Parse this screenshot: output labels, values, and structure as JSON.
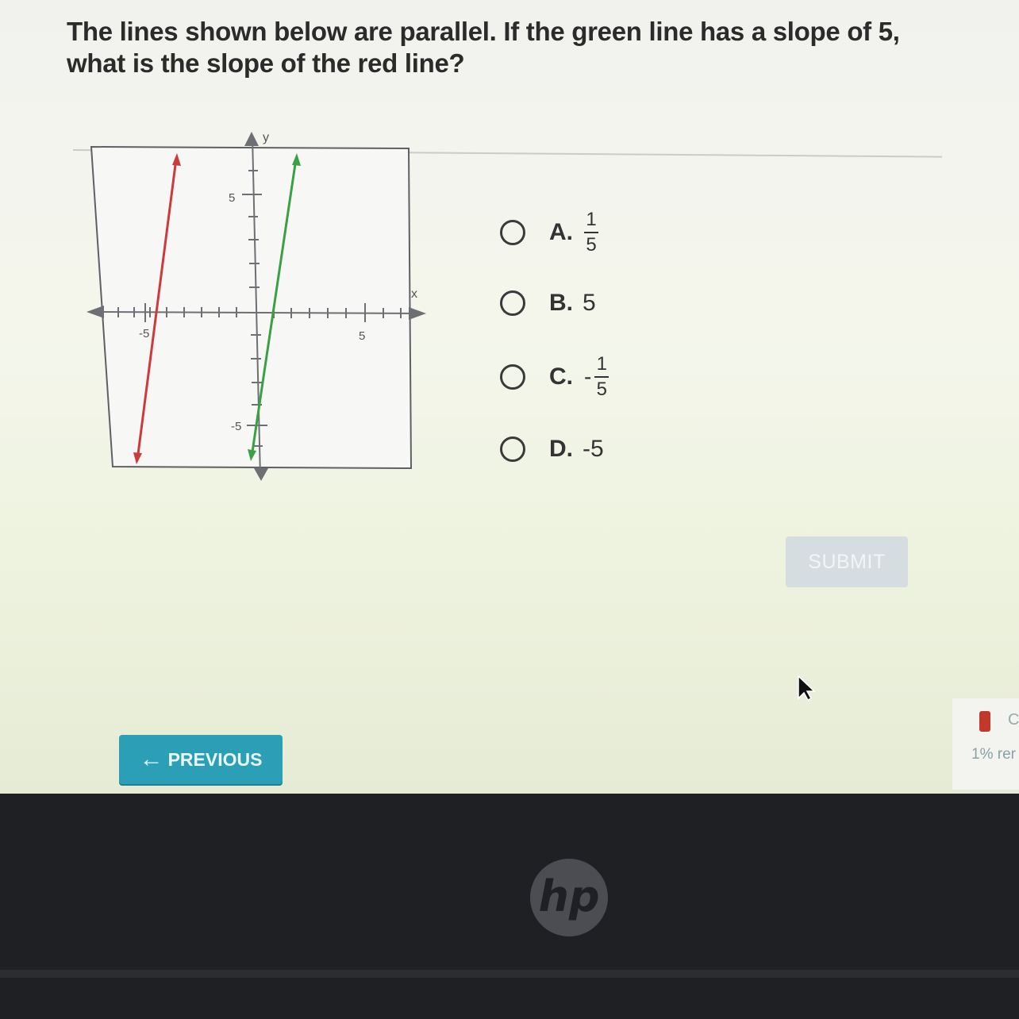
{
  "question": {
    "text": "The lines shown below are parallel. If the green line has a slope of 5, what is the slope of the red line?"
  },
  "graph": {
    "x_axis_label": "x",
    "y_axis_label": "y",
    "tick_labels": {
      "x_neg": "-5",
      "x_pos": "5",
      "y_pos": "5",
      "y_neg": "-5"
    },
    "colors": {
      "green_line": "#3aa043",
      "red_line": "#cc3b3b",
      "axes": "#6d6f74"
    }
  },
  "choices": [
    {
      "letter": "A.",
      "value": "",
      "frac_num": "1",
      "frac_den": "5",
      "sign": ""
    },
    {
      "letter": "B.",
      "value": "5",
      "frac_num": "",
      "frac_den": "",
      "sign": ""
    },
    {
      "letter": "C.",
      "value": "",
      "frac_num": "1",
      "frac_den": "5",
      "sign": "-"
    },
    {
      "letter": "D.",
      "value": "-5",
      "frac_num": "",
      "frac_den": "",
      "sign": ""
    }
  ],
  "buttons": {
    "submit_label": "SUBMIT",
    "previous_label": "PREVIOUS",
    "previous_icon": "arrow-left-icon"
  },
  "status": {
    "c_text": "C",
    "progress_text": "1% rer"
  },
  "device": {
    "logo_text": "hp"
  }
}
